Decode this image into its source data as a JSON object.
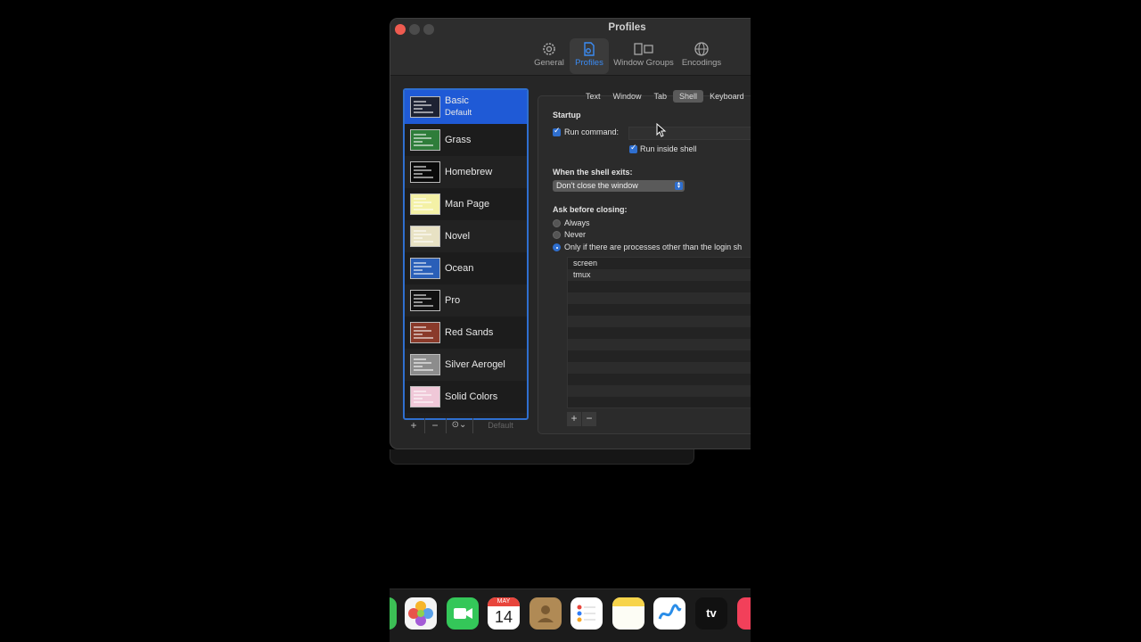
{
  "window": {
    "title": "Profiles",
    "toolbar": [
      {
        "label": "General",
        "icon": "gear-icon"
      },
      {
        "label": "Profiles",
        "icon": "profile-document-icon",
        "selected": true
      },
      {
        "label": "Window Groups",
        "icon": "window-groups-icon"
      },
      {
        "label": "Encodings",
        "icon": "globe-icon"
      }
    ]
  },
  "profiles": {
    "items": [
      {
        "name": "Basic",
        "subtitle": "Default",
        "selected": true,
        "thumb_bg": "#1d2233"
      },
      {
        "name": "Grass",
        "thumb_bg": "#2e7d3a"
      },
      {
        "name": "Homebrew",
        "thumb_bg": "#0a0a0a"
      },
      {
        "name": "Man Page",
        "thumb_bg": "#f4f1a6"
      },
      {
        "name": "Novel",
        "thumb_bg": "#e8e2c4"
      },
      {
        "name": "Ocean",
        "thumb_bg": "#2a5fb8"
      },
      {
        "name": "Pro",
        "thumb_bg": "#111111"
      },
      {
        "name": "Red Sands",
        "thumb_bg": "#8a3a2a"
      },
      {
        "name": "Silver Aerogel",
        "thumb_bg": "#8c8c8c"
      },
      {
        "name": "Solid Colors",
        "thumb_bg": "#f0c8d8"
      }
    ],
    "add_label": "+",
    "remove_label": "−",
    "actions_label": "⊙⌄",
    "default_label": "Default"
  },
  "tabs": [
    "Text",
    "Window",
    "Tab",
    "Shell",
    "Keyboard"
  ],
  "selected_tab": "Shell",
  "shell": {
    "startup_heading": "Startup",
    "run_command_label": "Run command:",
    "run_command_value": "",
    "run_inside_shell_label": "Run inside shell",
    "exit_heading": "When the shell exits:",
    "exit_option": "Don't close the window",
    "ask_heading": "Ask before closing:",
    "radio_always": "Always",
    "radio_never": "Never",
    "radio_only": "Only if there are processes other than the login sh",
    "processes": [
      "screen",
      "tmux",
      "",
      "",
      "",
      "",
      "",
      "",
      "",
      "",
      "",
      "",
      ""
    ],
    "add_label": "+",
    "remove_label": "−"
  },
  "dock": {
    "calendar_month": "MAY",
    "calendar_day": "14",
    "tv_label": "tv"
  },
  "colors": {
    "accent": "#2f6fcf",
    "selection": "#1f5ad6",
    "close": "#ee5b50"
  }
}
